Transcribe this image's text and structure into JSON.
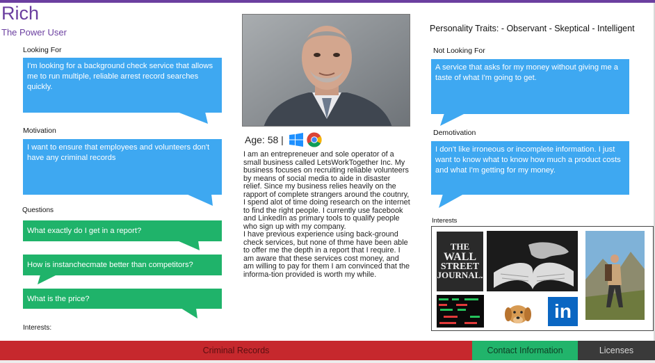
{
  "persona": {
    "name": "Rich",
    "role": "The Power User",
    "age_label": "Age: 58 |"
  },
  "looking_for": {
    "label": "Looking For",
    "text": "I'm looking for a background check  service that allows me to run multiple, reliable arrest record searches quickly."
  },
  "motivation": {
    "label": "Motivation",
    "text": "I want  to ensure that employees and volunteers don't have any criminal records"
  },
  "questions": {
    "label": "Questions",
    "items": [
      "What exactly do I get in a report?",
      "How is instanchecmate better than competitors?",
      "What is the price?"
    ]
  },
  "interests_left_label": "Interests:",
  "bio": [
    "I am an entrepreneuer and sole operator of a small business called LetsWorkTogether Inc. My business focuses on recruiting reliable volunteers by means of social media to aide in disaster relief. Since my business relies heavily on the rapport of complete strangers around the coutnry, I spend alot of time doing research on the internet to find the right people. I currently use facebook and LinkedIn as primary tools to qualify people who sign up with my company.",
    "I have previous experience using back-ground check services, but none of thme have been able to offer me  the depth in a report that I require. I am aware that these services cost money, and am willing to pay for them I am convinced that the informa-tion provided is worth my while."
  ],
  "traits": "Personality Traits: - Observant - Skeptical - Intelligent",
  "not_looking_for": {
    "label": "Not Looking For",
    "text": "A service that asks for my money without giving me a taste of what I'm going to get."
  },
  "demotivation": {
    "label": "Demotivation",
    "text": "I don't like irroneous or incomplete information. I just want to know what to know how much a product costs and what I'm getting for my money."
  },
  "interests": {
    "label": "Interests",
    "wsj_logo": [
      "THE",
      "WALL",
      "STREET",
      "JOURNAL."
    ],
    "linkedin_logo": "in"
  },
  "footer_tabs": {
    "criminal": "Criminal Records",
    "contact": "Contact Information",
    "licenses": "Licenses"
  },
  "colors": {
    "accent_purple": "#6b3fa0",
    "bubble_blue": "#3ea8f1",
    "bubble_green": "#1fb36a",
    "tab_red": "#c6282d",
    "tab_green": "#21b46b",
    "tab_dark": "#3a3a3a"
  },
  "icons": [
    "windows-icon",
    "chrome-icon"
  ]
}
